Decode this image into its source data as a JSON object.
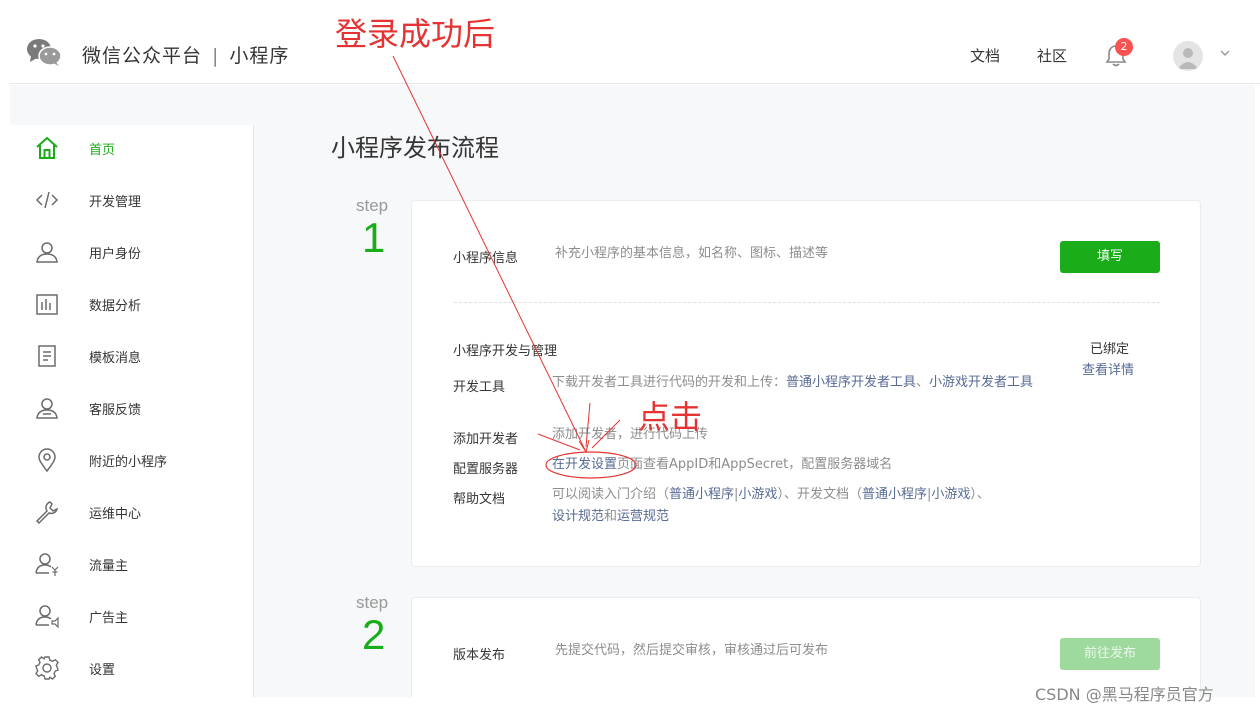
{
  "header": {
    "brand": "微信公众平台",
    "brand_sep": "|",
    "brand_sub": "小程序",
    "nav": [
      "文档",
      "社区"
    ],
    "notification_count": "2",
    "accent": "#1aad19"
  },
  "sidebar": {
    "items": [
      {
        "label": "首页",
        "icon": "home-icon",
        "active": true
      },
      {
        "label": "开发管理",
        "icon": "code-icon"
      },
      {
        "label": "用户身份",
        "icon": "user-icon"
      },
      {
        "label": "数据分析",
        "icon": "bar-chart-icon"
      },
      {
        "label": "模板消息",
        "icon": "document-icon"
      },
      {
        "label": "客服反馈",
        "icon": "support-icon"
      },
      {
        "label": "附近的小程序",
        "icon": "location-icon"
      },
      {
        "label": "运维中心",
        "icon": "wrench-icon"
      },
      {
        "label": "流量主",
        "icon": "user-yen-icon"
      },
      {
        "label": "广告主",
        "icon": "user-speaker-icon"
      },
      {
        "label": "设置",
        "icon": "gear-icon"
      }
    ]
  },
  "main": {
    "title": "小程序发布流程",
    "step_word": "step",
    "step1": {
      "number": "1",
      "info_label": "小程序信息",
      "info_desc": "补充小程序的基本信息，如名称、图标、描述等",
      "fill_button": "填写",
      "dev_title": "小程序开发与管理",
      "bound_status": "已绑定",
      "view_details": "查看详情",
      "tools_label": "开发工具",
      "tools_desc": "下载开发者工具进行代码的开发和上传：",
      "tools_link1": "普通小程序开发者工具",
      "tools_sep": "、",
      "tools_link2": "小游戏开发者工具",
      "add_dev_label": "添加开发者",
      "add_dev_desc": "添加开发者，进行代码上传",
      "server_label": "配置服务器",
      "server_link": "在开发设置",
      "server_desc": "页面查看AppID和AppSecret，配置服务器域名",
      "help_label": "帮助文档",
      "help_prefix": "可以阅读入门介绍（",
      "help_link_a": "普通小程序",
      "help_bar": "|",
      "help_link_b": "小游戏",
      "help_mid": "）、开发文档（",
      "help_link_c": "普通小程序",
      "help_link_d": "小游戏",
      "help_end": "）、",
      "help_link_e": "设计规范",
      "help_and": "和",
      "help_link_f": "运营规范"
    },
    "step2": {
      "number": "2",
      "release_label": "版本发布",
      "release_desc": "先提交代码，然后提交审核，审核通过后可发布",
      "release_button": "前往发布"
    }
  },
  "annotations": {
    "login_note": "登录成功后",
    "click_note": "点击",
    "color": "#e53333"
  },
  "watermark": "CSDN @黑马程序员官方"
}
